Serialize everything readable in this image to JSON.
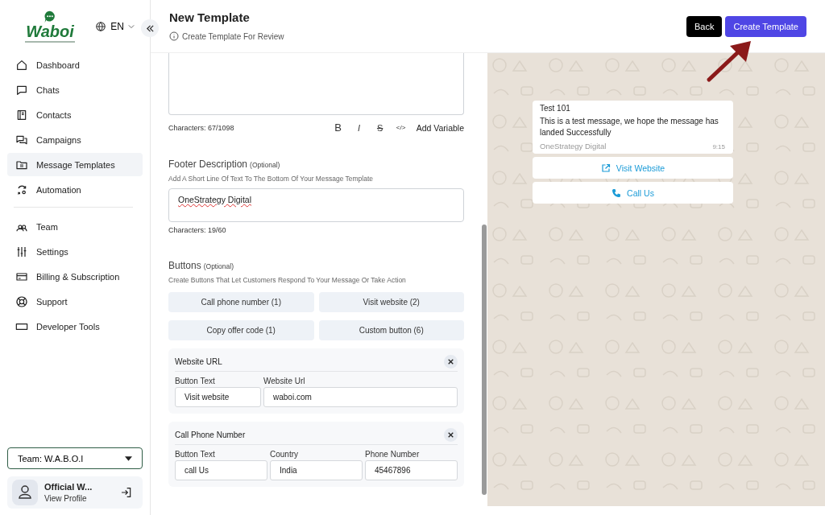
{
  "sidebar": {
    "logo": "Waboi",
    "language": "EN",
    "nav_groups": [
      [
        {
          "label": "Dashboard",
          "selected": false
        },
        {
          "label": "Chats",
          "selected": false
        },
        {
          "label": "Contacts",
          "selected": false
        },
        {
          "label": "Campaigns",
          "selected": false
        },
        {
          "label": "Message Templates",
          "selected": true
        },
        {
          "label": "Automation",
          "selected": false
        }
      ],
      [
        {
          "label": "Team",
          "selected": false
        },
        {
          "label": "Settings",
          "selected": false
        },
        {
          "label": "Billing & Subscription",
          "selected": false
        },
        {
          "label": "Support",
          "selected": false
        },
        {
          "label": "Developer Tools",
          "selected": false
        }
      ]
    ],
    "team": "Team: W.A.B.O.I",
    "profile": {
      "name": "Official W...",
      "link": "View Profile"
    }
  },
  "header": {
    "title": "New Template",
    "subtitle": "Create Template For Review",
    "buttons": [
      {
        "label": "Back",
        "kind": "secondary"
      },
      {
        "label": "Create Template",
        "kind": "primary"
      }
    ]
  },
  "body_editor": {
    "characters": "Characters: 67/1098",
    "format_tools": [
      {
        "label": "B",
        "kind": "bold"
      },
      {
        "label": "I",
        "kind": "italic"
      },
      {
        "label": "S",
        "kind": "strike"
      },
      {
        "label": "</>",
        "kind": "code"
      }
    ],
    "add_variable": "Add Variable"
  },
  "footer_section": {
    "title": "Footer Description",
    "optional": "(Optional)",
    "hint": "Add A Short Line Of Text To The Bottom Of Your Message Template",
    "value": "OneStrategy Digital",
    "characters": "Characters: 19/60"
  },
  "buttons_section": {
    "title": "Buttons",
    "optional": "(Optional)",
    "hint": "Create Buttons That Let Customers Respond To Your Message Or Take Action",
    "options": [
      "Call phone number (1)",
      "Visit website (2)",
      "Copy offer code (1)",
      "Custom button (6)"
    ],
    "cards": [
      {
        "title": "Website URL",
        "fields": [
          {
            "label": "Button Text",
            "value": "Visit website"
          },
          {
            "label": "Website Url",
            "value": "waboi.com"
          }
        ]
      },
      {
        "title": "Call Phone Number",
        "fields": [
          {
            "label": "Button Text",
            "value": "call Us"
          },
          {
            "label": "Country",
            "value": "India"
          },
          {
            "label": "Phone Number",
            "value": "45467896"
          }
        ]
      }
    ]
  },
  "preview": {
    "title": "Test 101",
    "body": "This is a test message, we hope the message has landed Successfully",
    "footer": "OneStrategy Digital",
    "time": "9:15",
    "buttons": [
      {
        "label": "Visit Website",
        "kind": "link"
      },
      {
        "label": "Call Us",
        "kind": "phone"
      }
    ]
  }
}
